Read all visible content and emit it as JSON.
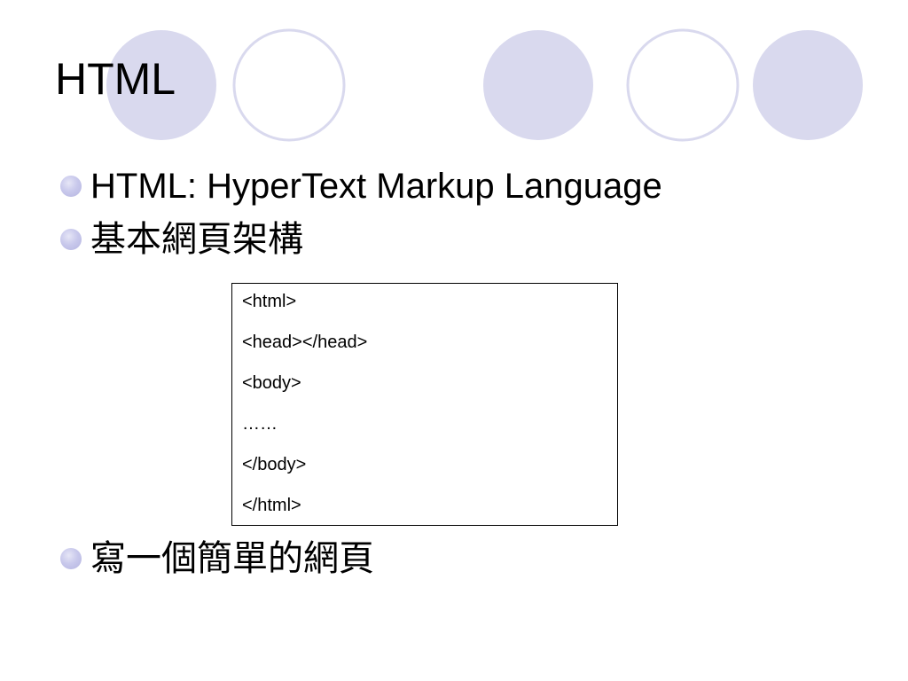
{
  "slide": {
    "title": "HTML",
    "bullets": [
      {
        "text": "HTML: HyperText Markup Language"
      },
      {
        "text": "基本網頁架構"
      },
      {
        "text": "寫一個簡單的網頁"
      }
    ],
    "code_lines": [
      "<html>",
      "<head></head>",
      "<body>",
      "……",
      "</body>",
      "</html>"
    ]
  },
  "colors": {
    "circle_fill": "#d9d9ee",
    "circle_outline": "#d9d9ee",
    "bullet": "#c4c4e8",
    "text": "#000000",
    "background": "#ffffff"
  }
}
